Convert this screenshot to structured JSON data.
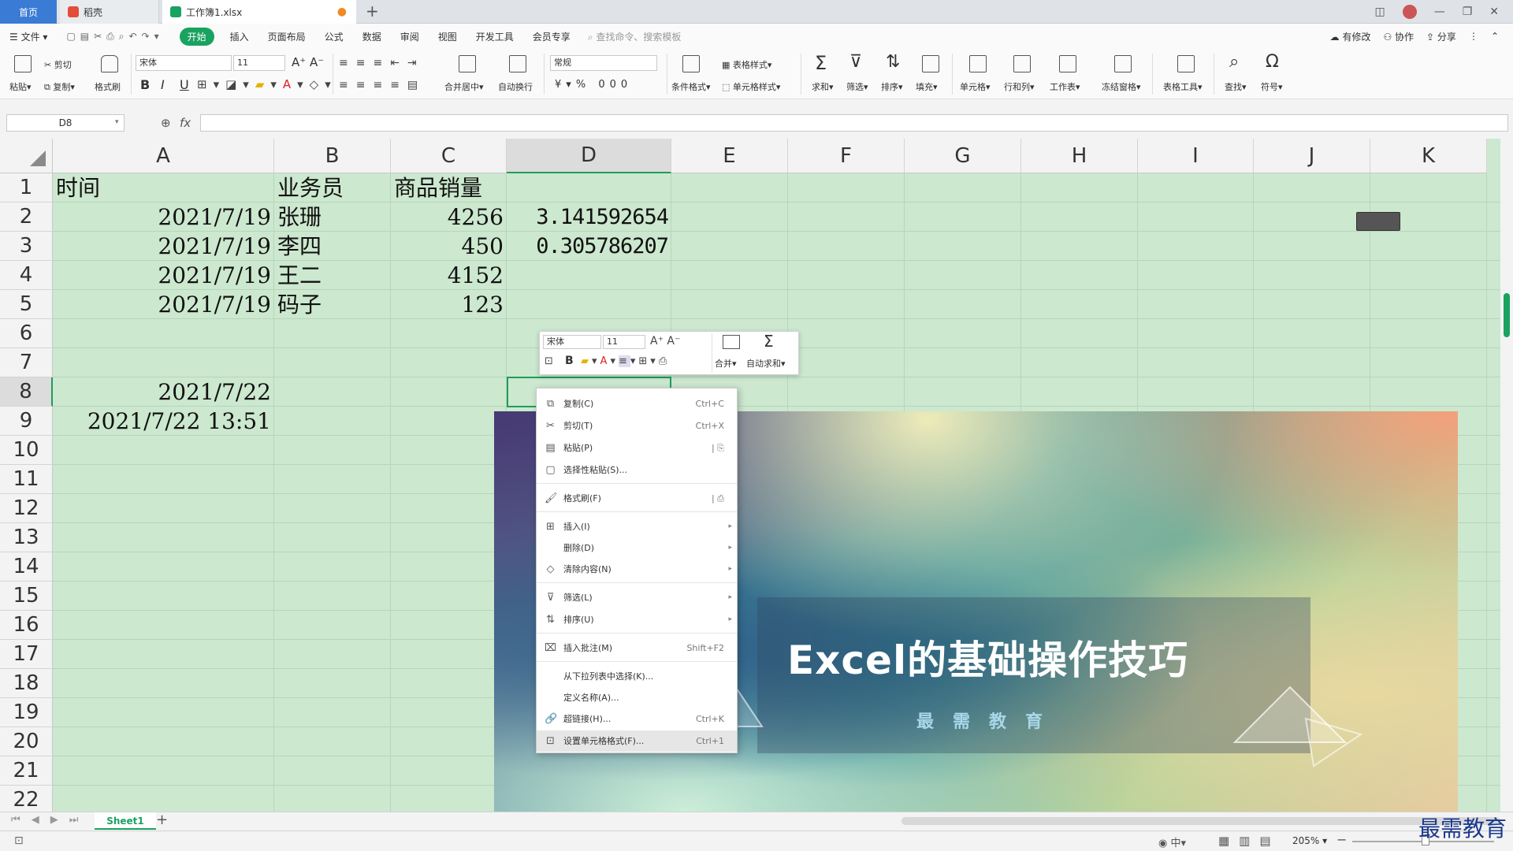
{
  "tabs": {
    "home": "首页",
    "daoke": "稻壳",
    "book": "工作簿1.xlsx"
  },
  "menu": {
    "file": "文件",
    "start": "开始",
    "items": [
      "插入",
      "页面布局",
      "公式",
      "数据",
      "审阅",
      "视图",
      "开发工具",
      "会员专享"
    ],
    "search": "查找命令、搜索模板",
    "modified": "有修改",
    "collab": "协作",
    "share": "分享"
  },
  "ribbon": {
    "paste": "粘贴",
    "cut": "剪切",
    "copy": "复制",
    "format_painter": "格式刷",
    "font": "宋体",
    "size": "11",
    "bold": "B",
    "italic": "I",
    "underline": "U",
    "merge": "合并居中",
    "wrap": "自动换行",
    "number_format": "常规",
    "currency": "¥",
    "percent": "%",
    "thousands": "000",
    "cond_format": "条件格式",
    "table_style": "表格样式",
    "cell_style": "单元格样式",
    "sum": "求和",
    "filter": "筛选",
    "sort": "排序",
    "fill": "填充",
    "cell": "单元格",
    "rowcol": "行和列",
    "sheet": "工作表",
    "freeze": "冻结窗格",
    "table_tools": "表格工具",
    "find": "查找",
    "symbol": "符号"
  },
  "formula_bar": {
    "name_box": "D8",
    "fx": "fx"
  },
  "columns": [
    "A",
    "B",
    "C",
    "D",
    "E",
    "F",
    "G",
    "H",
    "I",
    "J",
    "K"
  ],
  "rows": [
    "1",
    "2",
    "3",
    "4",
    "5",
    "6",
    "7",
    "8",
    "9",
    "10",
    "11",
    "12",
    "13",
    "14",
    "15",
    "16",
    "17",
    "18",
    "19",
    "20",
    "21",
    "22"
  ],
  "cells": {
    "A1": "时间",
    "B1": "业务员",
    "C1": "商品销量",
    "A2": "2021/7/19",
    "B2": "张珊",
    "C2": "4256",
    "D2": "3.141592654",
    "A3": "2021/7/19",
    "B3": "李四",
    "C3": "450",
    "D3": "0.305786207",
    "A4": "2021/7/19",
    "B4": "王二",
    "C4": "4152",
    "A5": "2021/7/19",
    "B5": "码子",
    "C5": "123",
    "A8": "2021/7/22",
    "A9": "2021/7/22  13:51"
  },
  "mini_toolbar": {
    "font": "宋体",
    "size": "11",
    "bold": "B",
    "merge": "合并",
    "autosum": "自动求和"
  },
  "context_menu": {
    "copy": "复制(C)",
    "copy_sc": "Ctrl+C",
    "cut": "剪切(T)",
    "cut_sc": "Ctrl+X",
    "paste": "粘贴(P)",
    "paste_special": "选择性粘贴(S)...",
    "format_painter": "格式刷(F)",
    "insert": "插入(I)",
    "delete": "删除(D)",
    "clear": "清除内容(N)",
    "filter": "筛选(L)",
    "sort": "排序(U)",
    "comment": "插入批注(M)",
    "comment_sc": "Shift+F2",
    "pick_list": "从下拉列表中选择(K)...",
    "define_name": "定义名称(A)...",
    "hyperlink": "超链接(H)...",
    "hyperlink_sc": "Ctrl+K",
    "format_cells": "设置单元格格式(F)...",
    "format_cells_sc": "Ctrl+1"
  },
  "banner": {
    "title": "Excel的基础操作技巧",
    "subtitle": "最需教育"
  },
  "sheets": [
    "Sheet1"
  ],
  "status": {
    "zoom": "205%",
    "ime": "中"
  },
  "watermark": "最需教育",
  "colors": {
    "grid_bg": "#cce8cf",
    "accent_green": "#1aa260",
    "tab_blue": "#3a7bd5",
    "selection": "#1e9e5a"
  }
}
